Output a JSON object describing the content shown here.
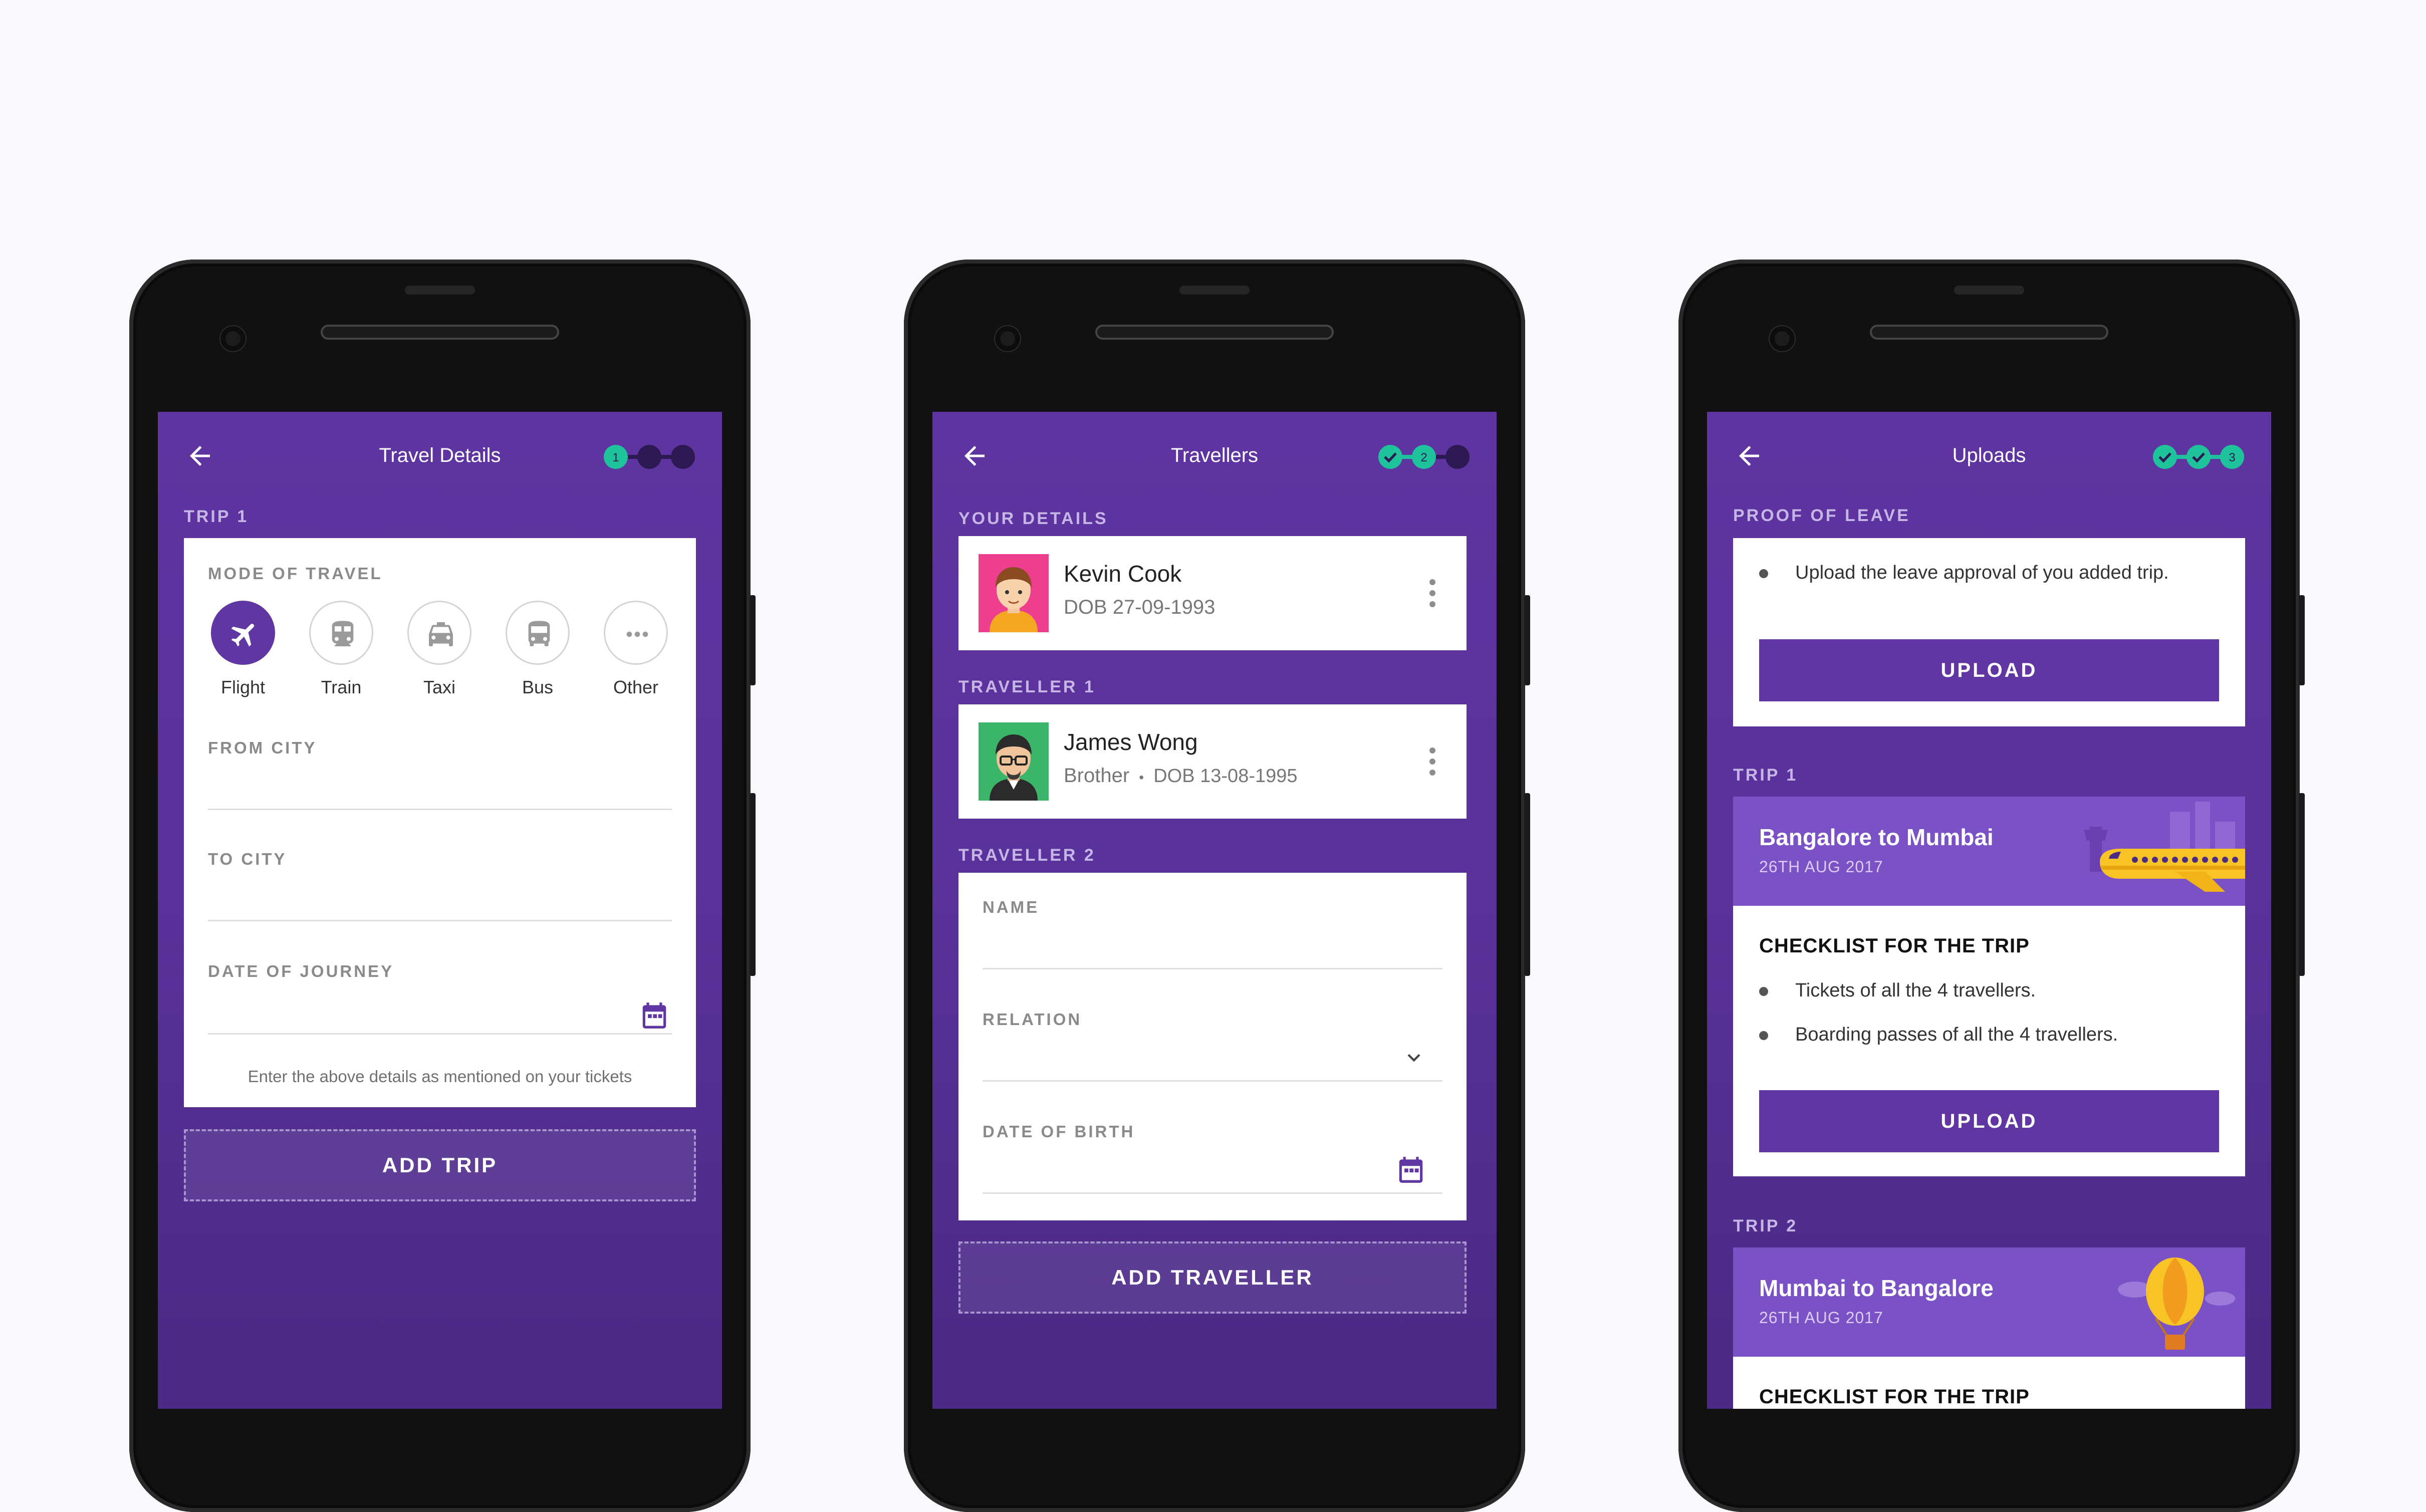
{
  "colors": {
    "primary": "#5f36a2",
    "accent_green": "#1fc39b",
    "background": "#f9f8fd"
  },
  "screen1": {
    "title": "Travel Details",
    "stepper": [
      "1",
      "",
      ""
    ],
    "section": "TRIP 1",
    "mode_label": "MODE OF TRAVEL",
    "modes": [
      {
        "label": "Flight",
        "icon": "airplane-icon",
        "active": true
      },
      {
        "label": "Train",
        "icon": "train-icon",
        "active": false
      },
      {
        "label": "Taxi",
        "icon": "taxi-icon",
        "active": false
      },
      {
        "label": "Bus",
        "icon": "bus-icon",
        "active": false
      },
      {
        "label": "Other",
        "icon": "more-horizontal-icon",
        "active": false
      }
    ],
    "from_city_label": "FROM CITY",
    "to_city_label": "TO CITY",
    "date_label": "DATE OF JOURNEY",
    "hint": "Enter the above details as mentioned on your tickets",
    "add_trip": "ADD TRIP"
  },
  "screen2": {
    "title": "Travellers",
    "stepper": [
      "check",
      "2",
      ""
    ],
    "your_details": "YOUR DETAILS",
    "me": {
      "name": "Kevin Cook",
      "dob": "DOB 27-09-1993"
    },
    "traveller1_label": "TRAVELLER 1",
    "traveller1": {
      "name": "James Wong",
      "relation": "Brother",
      "dob": "DOB  13-08-1995"
    },
    "traveller2_label": "TRAVELLER 2",
    "name_label": "NAME",
    "relation_label": "RELATION",
    "dob_label": "DATE OF BIRTH",
    "add_traveller": "ADD TRAVELLER"
  },
  "screen3": {
    "title": "Uploads",
    "stepper": [
      "check",
      "check",
      "3"
    ],
    "proof_label": "PROOF OF LEAVE",
    "proof_text": "Upload the leave approval of you added trip.",
    "upload": "UPLOAD",
    "trip1_label": "TRIP 1",
    "trip1": {
      "title": "Bangalore to Mumbai",
      "date": "26TH AUG 2017"
    },
    "checklist_title": "CHECKLIST FOR THE TRIP",
    "checklist": [
      "Tickets of all the 4 travellers.",
      "Boarding passes of all the 4 travellers."
    ],
    "trip2_label": "TRIP 2",
    "trip2": {
      "title": "Mumbai to Bangalore",
      "date": "26TH AUG 2017"
    }
  }
}
